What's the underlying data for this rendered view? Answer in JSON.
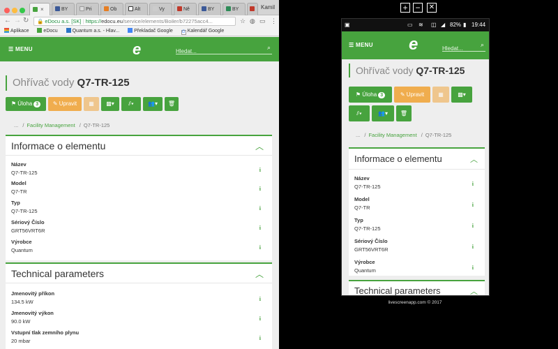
{
  "browser": {
    "tabs": [
      "BY",
      "Pri",
      "Ob",
      "Alt",
      "Vy",
      "Ně",
      "BY",
      "BY",
      "Ch"
    ],
    "user": "Kamil",
    "url_prefix": "eDocu a.s. [SK]",
    "url_scheme": "https://",
    "url_host": "edocu.eu",
    "url_path": "/service/elements/Boiler/b72275acc4..."
  },
  "bookmarks": [
    "Aplikace",
    "eDocu",
    "Quantum a.s. - Hlav...",
    "Překladač Google",
    "Kalendář Google"
  ],
  "app": {
    "menu_label": "MENU",
    "logo": "e",
    "search_placeholder": "Hledat...",
    "title_prefix": "Ohřívač vody",
    "title_code": "Q7-TR-125",
    "btn_task": "Úloha",
    "task_count": "3",
    "btn_edit": "Upravit",
    "breadcrumbs": [
      "...",
      "Facility Management",
      "Q7-TR-125"
    ],
    "info_panel_title": "Informace o elementu",
    "info_rows": [
      {
        "label": "Název",
        "value": "Q7-TR-125"
      },
      {
        "label": "Model",
        "value": "Q7-TR"
      },
      {
        "label": "Typ",
        "value": "Q7-TR-125"
      },
      {
        "label": "Sériový Číslo",
        "value": "GRT56VRT6R"
      },
      {
        "label": "Výrobce",
        "value": "Quantum"
      }
    ],
    "tech_panel_title": "Technical parameters",
    "tech_rows": [
      {
        "label": "Jmenovitý příkon",
        "value": "134.5 kW"
      },
      {
        "label": "Jmenovitý výkon",
        "value": "90.0 kW"
      },
      {
        "label": "Vstupní tlak zemního plynu",
        "value": "20 mbar"
      }
    ],
    "info_icon": "i"
  },
  "phone": {
    "battery": "82%",
    "time": "19:44"
  },
  "footer": "livescreenapp.com © 2017",
  "colors": {
    "green": "#47a33e",
    "orange": "#f0ad4e"
  }
}
